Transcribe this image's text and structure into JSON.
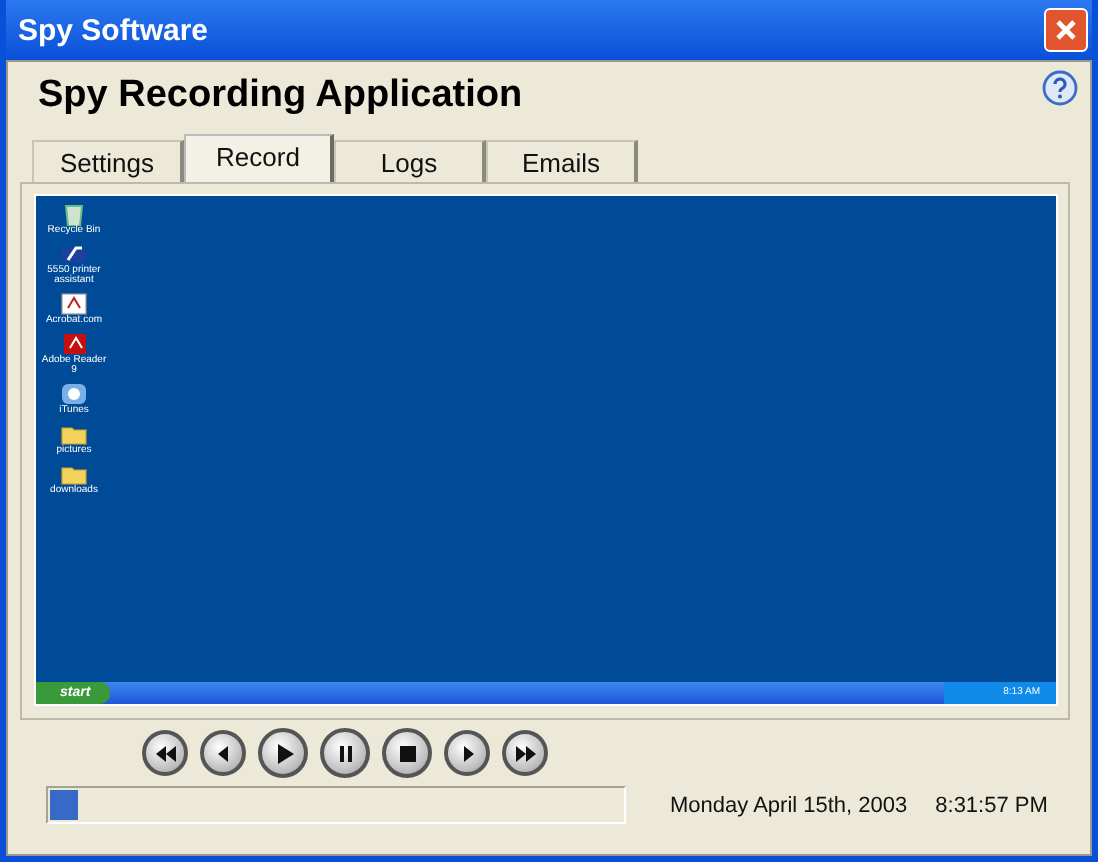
{
  "window": {
    "title": "Spy Software"
  },
  "header": {
    "title": "Spy Recording Application"
  },
  "tabs": [
    {
      "label": "Settings",
      "selected": false
    },
    {
      "label": "Record",
      "selected": true
    },
    {
      "label": "Logs",
      "selected": false
    },
    {
      "label": "Emails",
      "selected": false
    }
  ],
  "recorded_screen": {
    "desktop_icons": [
      {
        "label": "Recycle Bin",
        "kind": "recycle"
      },
      {
        "label": "5550 printer assistant",
        "kind": "printer"
      },
      {
        "label": "Acrobat.com",
        "kind": "document"
      },
      {
        "label": "Adobe Reader 9",
        "kind": "reader"
      },
      {
        "label": "iTunes",
        "kind": "music"
      },
      {
        "label": "pictures",
        "kind": "folder"
      },
      {
        "label": "downloads",
        "kind": "folder"
      }
    ],
    "taskbar": {
      "start": "start",
      "clock": "8:13 AM"
    }
  },
  "playback_controls": [
    {
      "kind": "rewind"
    },
    {
      "kind": "previous"
    },
    {
      "kind": "play"
    },
    {
      "kind": "pause"
    },
    {
      "kind": "stop"
    },
    {
      "kind": "next"
    },
    {
      "kind": "fast-forward"
    }
  ],
  "progress": {
    "level": 0.05
  },
  "status": {
    "date": "Monday April 15th, 2003",
    "time": "8:31:57 PM"
  }
}
